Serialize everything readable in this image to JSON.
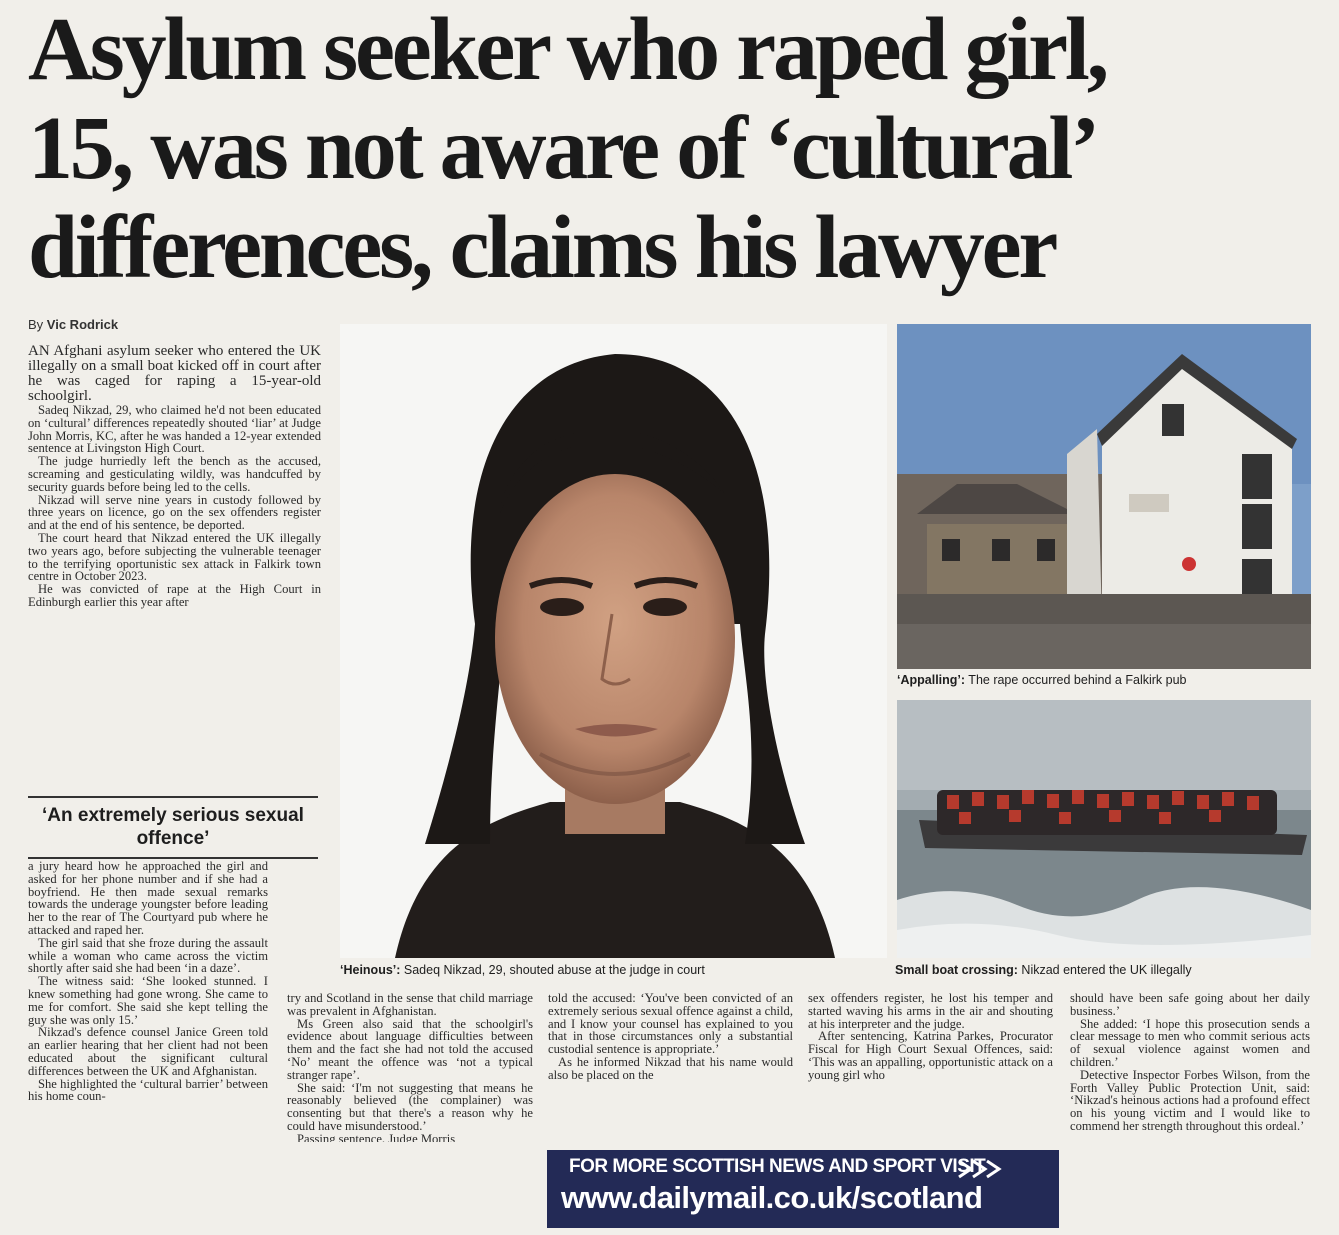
{
  "headline": {
    "line1": "Asylum seeker who raped girl,",
    "line2": "15, was not aware of ‘cultural’",
    "line3": "differences, claims his lawyer"
  },
  "byline": {
    "prefix": "By ",
    "name": "Vic Rodrick"
  },
  "col1_top": [
    "AN Afghani asylum seeker who entered the UK illegally on a small boat kicked off in court after he was caged for raping a 15-year-old schoolgirl.",
    "Sadeq Nikzad, 29, who claimed he'd not been educated on ‘cultural’ differences repeatedly shouted ‘liar’ at Judge John Morris, KC, after he was handed a 12-year extended sentence at Livingston High Court.",
    "The judge hurriedly left the bench as the accused, screaming and gesticulating wildly, was handcuffed by security guards before being led to the cells.",
    "Nikzad will serve nine years in custody followed by three years on licence, go on the sex offenders register and at the end of his sentence, be deported.",
    "The court heard that Nikzad entered the UK illegally two years ago, before subjecting the vulnerable teenager to the terrifying oportunistic sex attack in Falkirk town centre in October 2023.",
    "He was convicted of rape at the High Court in Edinburgh earlier this year after"
  ],
  "pullquote": "‘An extremely serious sexual offence’",
  "col1_bottom": [
    "a jury heard how he approached the girl and asked for her phone number and if she had a boyfriend. He then made sexual remarks towards the underage youngster before leading her to the rear of The Courtyard pub where he attacked and raped her.",
    "The girl said that she froze during the assault while a woman who came across the victim shortly after said she had been ‘in a daze’.",
    "The witness said: ‘She looked stunned. I knew something had gone wrong. She came to me for comfort. She said she kept telling the guy she was only 15.’",
    "Nikzad's defence counsel Janice Green told an earlier hearing that her client had not been educated about the significant cultural differences between the UK and Afghanistan.",
    "She highlighted the ‘cultural barrier’ between his home coun-"
  ],
  "col2": [
    "try and Scotland in the sense that child marriage was prevalent in Afghanistan.",
    "Ms Green also said that the schoolgirl's evidence about language difficulties between them and the fact she had not told the accused ‘No’ meant the offence was ‘not a typical stranger rape’.",
    "She said: ‘I'm not suggesting that means he reasonably believed (the complainer) was consenting but that there's a reason why he could have misunderstood.’",
    "Passing sentence, Judge Morris"
  ],
  "col3": [
    "told the accused: ‘You've been convicted of an extremely serious sexual offence against a child, and I know your counsel has explained to you that in those circumstances only a substantial custodial sentence is appropriate.’",
    "As he informed Nikzad that his name would also be placed on the"
  ],
  "col4": [
    "sex offenders register, he lost his temper and started waving his arms in the air and shouting at his interpreter and the judge.",
    "After sentencing, Katrina Parkes, Procurator Fiscal for High Court Sexual Offences, said: ‘This was an appalling, opportunistic attack on a young girl who"
  ],
  "col5": [
    "should have been safe going about her daily business.’",
    "She added: ‘I hope this prosecution sends a clear message to men who commit serious acts of sexual violence against women and children.’",
    "Detective Inspector Forbes Wilson, from the Forth Valley Public Protection Unit, said: ‘Nikzad's heinous actions had a profound effect on his young victim and I would like to commend her strength throughout this ordeal.’"
  ],
  "captions": {
    "portrait_bold": "‘Heinous’:",
    "portrait_text": " Sadeq Nikzad, 29, shouted abuse at the judge in court",
    "pub_bold": "‘Appalling’:",
    "pub_text": " The rape occurred behind a Falkirk pub",
    "boat_bold": "Small boat crossing:",
    "boat_text": " Nikzad entered the UK illegally"
  },
  "promo": {
    "line1": "FOR MORE SCOTTISH NEWS AND SPORT VISIT",
    "line2": "www.dailymail.co.uk/scotland"
  }
}
